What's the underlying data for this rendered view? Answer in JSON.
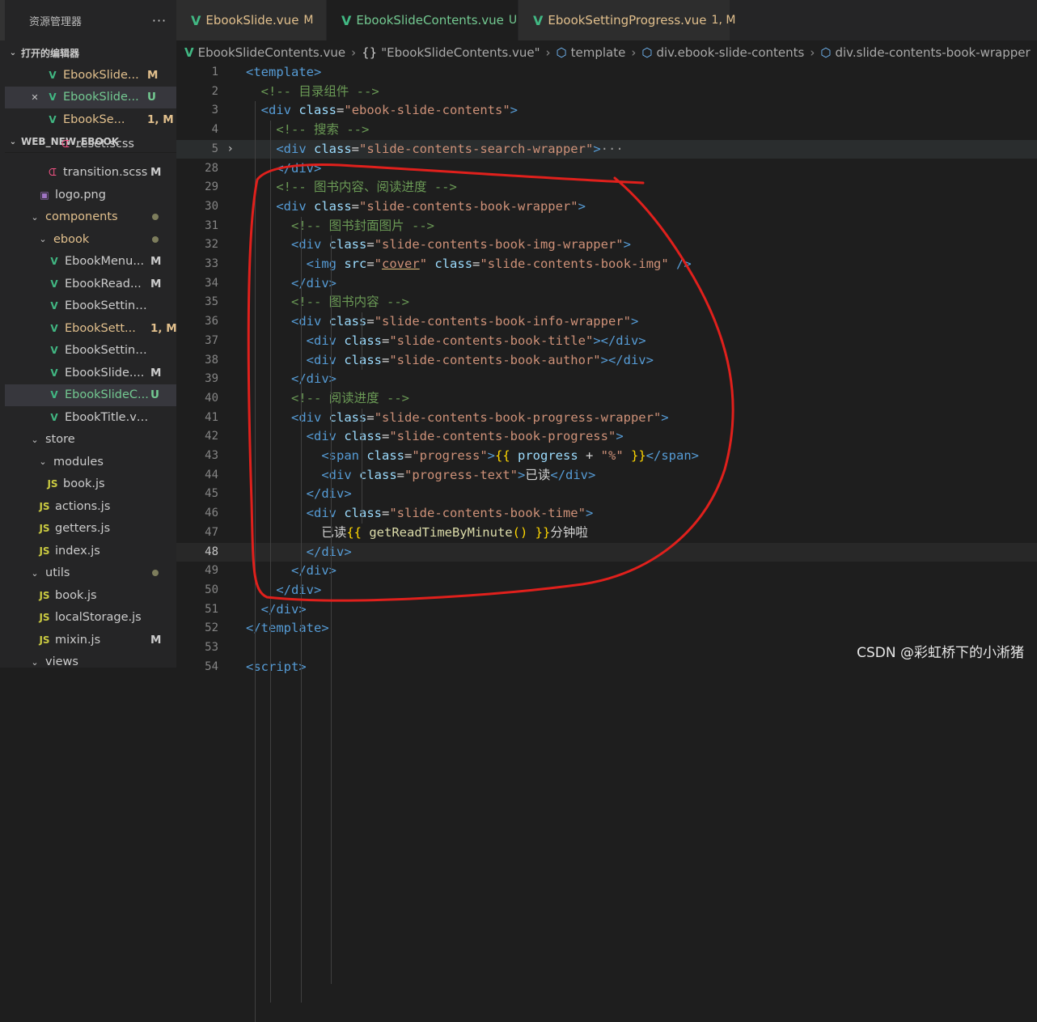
{
  "explorer": {
    "title": "资源管理器",
    "more": "···",
    "open_editors_label": "打开的编辑器",
    "open_editors": [
      {
        "name": "EbookSlide...",
        "badge": "M",
        "state": "mod",
        "close": ""
      },
      {
        "name": "EbookSlide...",
        "badge": "U",
        "state": "new",
        "close": "✕"
      },
      {
        "name": "EbookSe...",
        "badge": "1, M",
        "state": "mod",
        "close": ""
      }
    ],
    "project_label": "WEB_NEW_EBOOK",
    "tree": [
      {
        "name": "reset.scss",
        "icon": "scss",
        "badge": "",
        "state": "norm",
        "partial": true
      },
      {
        "name": "transition.scss",
        "icon": "scss",
        "badge": "M",
        "state": "norm"
      },
      {
        "name": "logo.png",
        "icon": "png",
        "badge": "",
        "state": "norm"
      },
      {
        "name": "components",
        "icon": "folder-open",
        "badge": "dot",
        "state": "mod"
      },
      {
        "name": "ebook",
        "icon": "folder-open",
        "badge": "dot",
        "state": "mod"
      },
      {
        "name": "EbookMenu...",
        "icon": "vue",
        "badge": "M",
        "state": "norm"
      },
      {
        "name": "EbookRead...",
        "icon": "vue",
        "badge": "M",
        "state": "norm"
      },
      {
        "name": "EbookSettingFont...",
        "icon": "vue",
        "badge": "",
        "state": "norm"
      },
      {
        "name": "EbookSett...",
        "icon": "vue",
        "badge": "1, M",
        "state": "mod"
      },
      {
        "name": "EbookSettingThe...",
        "icon": "vue",
        "badge": "",
        "state": "norm"
      },
      {
        "name": "EbookSlide....",
        "icon": "vue",
        "badge": "M",
        "state": "norm"
      },
      {
        "name": "EbookSlideC...",
        "icon": "vue",
        "badge": "U",
        "state": "new"
      },
      {
        "name": "EbookTitle.vue",
        "icon": "vue",
        "badge": "",
        "state": "norm"
      },
      {
        "name": "store",
        "icon": "folder-open",
        "badge": "",
        "state": "norm"
      },
      {
        "name": "modules",
        "icon": "folder-open",
        "badge": "",
        "state": "norm"
      },
      {
        "name": "book.js",
        "icon": "js",
        "badge": "",
        "state": "norm"
      },
      {
        "name": "actions.js",
        "icon": "js",
        "badge": "",
        "state": "norm"
      },
      {
        "name": "getters.js",
        "icon": "js",
        "badge": "",
        "state": "norm"
      },
      {
        "name": "index.js",
        "icon": "js",
        "badge": "",
        "state": "norm"
      },
      {
        "name": "utils",
        "icon": "folder-open",
        "badge": "dot",
        "state": "norm"
      },
      {
        "name": "book.js",
        "icon": "js",
        "badge": "",
        "state": "norm"
      },
      {
        "name": "localStorage.js",
        "icon": "js",
        "badge": "",
        "state": "norm"
      },
      {
        "name": "mixin.js",
        "icon": "js",
        "badge": "M",
        "state": "norm"
      },
      {
        "name": "views",
        "icon": "folder-open",
        "badge": "",
        "state": "norm"
      }
    ]
  },
  "tabs": [
    {
      "name": "EbookSlide.vue",
      "badge": "M",
      "state": "mod",
      "active": false,
      "close": ""
    },
    {
      "name": "EbookSlideContents.vue",
      "badge": "U",
      "state": "new",
      "active": true,
      "close": "✕"
    },
    {
      "name": "EbookSettingProgress.vue",
      "badge": "1, M",
      "state": "mod",
      "active": false,
      "close": ""
    }
  ],
  "breadcrumb": {
    "file": "EbookSlideContents.vue",
    "block": "\"EbookSlideContents.vue\"",
    "template": "template",
    "div1": "div.ebook-slide-contents",
    "div2": "div.slide-contents-book-wrapper",
    "braces": "{}"
  },
  "editor": {
    "lines": [
      {
        "n": "1",
        "tokens": [
          [
            "tag",
            "<template"
          ],
          [
            "tag",
            ">"
          ]
        ]
      },
      {
        "n": "2",
        "tokens": [
          [
            "txt",
            "  "
          ],
          [
            "com",
            "<!-- 目录组件 -->"
          ]
        ]
      },
      {
        "n": "3",
        "tokens": [
          [
            "txt",
            "  "
          ],
          [
            "tag",
            "<div "
          ],
          [
            "attr",
            "class"
          ],
          [
            "txt",
            "="
          ],
          [
            "str",
            "\"ebook-slide-contents\""
          ],
          [
            "tag",
            ">"
          ]
        ]
      },
      {
        "n": "4",
        "tokens": [
          [
            "txt",
            "    "
          ],
          [
            "com",
            "<!-- 搜索 -->"
          ]
        ]
      },
      {
        "n": "5",
        "tokens": [
          [
            "txt",
            "    "
          ],
          [
            "tag",
            "<div "
          ],
          [
            "attr",
            "class"
          ],
          [
            "txt",
            "="
          ],
          [
            "str",
            "\"slide-contents-search-wrapper\""
          ],
          [
            "tag",
            ">"
          ],
          [
            "ell",
            "···"
          ]
        ],
        "fold": "›"
      },
      {
        "n": "28",
        "tokens": [
          [
            "txt",
            "    "
          ],
          [
            "tag",
            "</div>"
          ]
        ]
      },
      {
        "n": "29",
        "tokens": [
          [
            "txt",
            "    "
          ],
          [
            "com",
            "<!-- 图书内容、阅读进度 -->"
          ]
        ]
      },
      {
        "n": "30",
        "tokens": [
          [
            "txt",
            "    "
          ],
          [
            "tag",
            "<div "
          ],
          [
            "attr",
            "class"
          ],
          [
            "txt",
            "="
          ],
          [
            "str",
            "\"slide-contents-book-wrapper\""
          ],
          [
            "tag",
            ">"
          ]
        ]
      },
      {
        "n": "31",
        "tokens": [
          [
            "txt",
            "      "
          ],
          [
            "com",
            "<!-- 图书封面图片 -->"
          ]
        ]
      },
      {
        "n": "32",
        "tokens": [
          [
            "txt",
            "      "
          ],
          [
            "tag",
            "<div "
          ],
          [
            "attr",
            "class"
          ],
          [
            "txt",
            "="
          ],
          [
            "str",
            "\"slide-contents-book-img-wrapper\""
          ],
          [
            "tag",
            ">"
          ]
        ]
      },
      {
        "n": "33",
        "tokens": [
          [
            "txt",
            "        "
          ],
          [
            "tag",
            "<img "
          ],
          [
            "attr",
            "src"
          ],
          [
            "txt",
            "="
          ],
          [
            "str",
            "\""
          ],
          [
            "strul",
            "cover"
          ],
          [
            "str",
            "\""
          ],
          [
            "txt",
            " "
          ],
          [
            "attr",
            "class"
          ],
          [
            "txt",
            "="
          ],
          [
            "str",
            "\"slide-contents-book-img\""
          ],
          [
            "txt",
            " "
          ],
          [
            "tag",
            "/>"
          ]
        ]
      },
      {
        "n": "34",
        "tokens": [
          [
            "txt",
            "      "
          ],
          [
            "tag",
            "</div>"
          ]
        ]
      },
      {
        "n": "35",
        "tokens": [
          [
            "txt",
            "      "
          ],
          [
            "com",
            "<!-- 图书内容 -->"
          ]
        ]
      },
      {
        "n": "36",
        "tokens": [
          [
            "txt",
            "      "
          ],
          [
            "tag",
            "<div "
          ],
          [
            "attr",
            "class"
          ],
          [
            "txt",
            "="
          ],
          [
            "str",
            "\"slide-contents-book-info-wrapper\""
          ],
          [
            "tag",
            ">"
          ]
        ]
      },
      {
        "n": "37",
        "tokens": [
          [
            "txt",
            "        "
          ],
          [
            "tag",
            "<div "
          ],
          [
            "attr",
            "class"
          ],
          [
            "txt",
            "="
          ],
          [
            "str",
            "\"slide-contents-book-title\""
          ],
          [
            "tag",
            "></div>"
          ]
        ]
      },
      {
        "n": "38",
        "tokens": [
          [
            "txt",
            "        "
          ],
          [
            "tag",
            "<div "
          ],
          [
            "attr",
            "class"
          ],
          [
            "txt",
            "="
          ],
          [
            "str",
            "\"slide-contents-book-author\""
          ],
          [
            "tag",
            "></div>"
          ]
        ]
      },
      {
        "n": "39",
        "tokens": [
          [
            "txt",
            "      "
          ],
          [
            "tag",
            "</div>"
          ]
        ]
      },
      {
        "n": "40",
        "tokens": [
          [
            "txt",
            "      "
          ],
          [
            "com",
            "<!-- 阅读进度 -->"
          ]
        ]
      },
      {
        "n": "41",
        "tokens": [
          [
            "txt",
            "      "
          ],
          [
            "tag",
            "<div "
          ],
          [
            "attr",
            "class"
          ],
          [
            "txt",
            "="
          ],
          [
            "str",
            "\"slide-contents-book-progress-wrapper\""
          ],
          [
            "tag",
            ">"
          ]
        ]
      },
      {
        "n": "42",
        "tokens": [
          [
            "txt",
            "        "
          ],
          [
            "tag",
            "<div "
          ],
          [
            "attr",
            "class"
          ],
          [
            "txt",
            "="
          ],
          [
            "str",
            "\"slide-contents-book-progress\""
          ],
          [
            "tag",
            ">"
          ]
        ]
      },
      {
        "n": "43",
        "tokens": [
          [
            "txt",
            "          "
          ],
          [
            "tag",
            "<span "
          ],
          [
            "attr",
            "class"
          ],
          [
            "txt",
            "="
          ],
          [
            "str",
            "\"progress\""
          ],
          [
            "tag",
            ">"
          ],
          [
            "mus",
            "{{ "
          ],
          [
            "var",
            "progress"
          ],
          [
            "txt",
            " + "
          ],
          [
            "str",
            "\"%\""
          ],
          [
            "mus",
            " }}"
          ],
          [
            "tag",
            "</span>"
          ]
        ]
      },
      {
        "n": "44",
        "tokens": [
          [
            "txt",
            "          "
          ],
          [
            "tag",
            "<div "
          ],
          [
            "attr",
            "class"
          ],
          [
            "txt",
            "="
          ],
          [
            "str",
            "\"progress-text\""
          ],
          [
            "tag",
            ">"
          ],
          [
            "txt",
            "已读"
          ],
          [
            "tag",
            "</div>"
          ]
        ]
      },
      {
        "n": "45",
        "tokens": [
          [
            "txt",
            "        "
          ],
          [
            "tag",
            "</div>"
          ]
        ]
      },
      {
        "n": "46",
        "tokens": [
          [
            "txt",
            "        "
          ],
          [
            "tag",
            "<div "
          ],
          [
            "attr",
            "class"
          ],
          [
            "txt",
            "="
          ],
          [
            "str",
            "\"slide-contents-book-time\""
          ],
          [
            "tag",
            ">"
          ]
        ]
      },
      {
        "n": "47",
        "tokens": [
          [
            "txt",
            "          已读"
          ],
          [
            "mus",
            "{{ "
          ],
          [
            "fn",
            "getReadTimeByMinute"
          ],
          [
            "mus",
            "()"
          ],
          [
            "mus",
            " }}"
          ],
          [
            "txt",
            "分钟啦"
          ]
        ]
      },
      {
        "n": "48",
        "tokens": [
          [
            "txt",
            "        "
          ],
          [
            "tag",
            "</div>"
          ]
        ],
        "current": true
      },
      {
        "n": "49",
        "tokens": [
          [
            "txt",
            "      "
          ],
          [
            "tag",
            "</div>"
          ]
        ]
      },
      {
        "n": "50",
        "tokens": [
          [
            "txt",
            "    "
          ],
          [
            "tag",
            "</div>"
          ]
        ]
      },
      {
        "n": "51",
        "tokens": [
          [
            "txt",
            "  "
          ],
          [
            "tag",
            "</div>"
          ]
        ]
      },
      {
        "n": "52",
        "tokens": [
          [
            "tag",
            "</template>"
          ]
        ]
      },
      {
        "n": "53",
        "tokens": []
      },
      {
        "n": "54",
        "tokens": [
          [
            "tag",
            "<script>"
          ]
        ]
      }
    ]
  },
  "watermark": "CSDN @彩虹桥下的小淅猪",
  "colors": {
    "annotation": "#e0201c",
    "modified": "#e2c08d",
    "untracked": "#73c991",
    "vue": "#41b883"
  }
}
